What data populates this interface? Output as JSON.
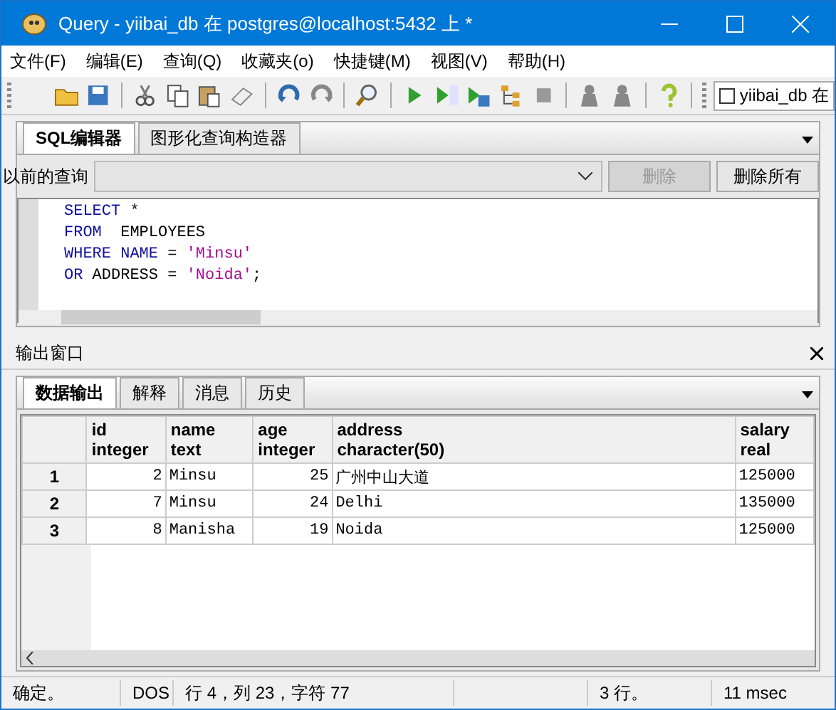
{
  "window": {
    "title": "Query - yiibai_db 在  postgres@localhost:5432 上 *"
  },
  "menu": [
    "文件(F)",
    "编辑(E)",
    "查询(Q)",
    "收藏夹(o)",
    "快捷键(M)",
    "视图(V)",
    "帮助(H)"
  ],
  "toolbar": {
    "database_combo": {
      "label": "yiibai_db 在",
      "checked": false
    }
  },
  "editor_tabs": [
    {
      "label": "SQL编辑器",
      "selected": true
    },
    {
      "label": "图形化查询构造器",
      "selected": false
    }
  ],
  "previous_queries": {
    "label": "以前的查询",
    "buttons": [
      {
        "label": "删除",
        "disabled": true
      },
      {
        "label": "删除所有",
        "disabled": false
      }
    ]
  },
  "sql_lines": [
    [
      {
        "kind": "keyword",
        "text": "SELECT"
      },
      {
        "kind": "plain",
        "text": " *"
      }
    ],
    [
      {
        "kind": "keyword",
        "text": "FROM"
      },
      {
        "kind": "plain",
        "text": "  EMPLOYEES"
      }
    ],
    [
      {
        "kind": "keyword",
        "text": "WHERE NAME"
      },
      {
        "kind": "plain",
        "text": " = "
      },
      {
        "kind": "string",
        "text": "'Minsu'"
      }
    ],
    [
      {
        "kind": "keyword",
        "text": "OR"
      },
      {
        "kind": "plain",
        "text": " ADDRESS = "
      },
      {
        "kind": "string",
        "text": "'Noida'"
      },
      {
        "kind": "plain",
        "text": ";"
      }
    ]
  ],
  "output": {
    "title": "输出窗口",
    "tabs": [
      {
        "label": "数据输出",
        "selected": true
      },
      {
        "label": "解释",
        "selected": false
      },
      {
        "label": "消息",
        "selected": false
      },
      {
        "label": "历史",
        "selected": false
      }
    ],
    "table": {
      "columns": [
        {
          "name": "id",
          "type": "integer"
        },
        {
          "name": "name",
          "type": "text"
        },
        {
          "name": "age",
          "type": "integer"
        },
        {
          "name": "address",
          "type": "character(50)"
        },
        {
          "name": "salary",
          "type": "real"
        }
      ],
      "rows": [
        {
          "number": "1",
          "cells": [
            "2",
            "Minsu",
            "25",
            "广州中山大道",
            "125000"
          ]
        },
        {
          "number": "2",
          "cells": [
            "7",
            "Minsu",
            "24",
            "Delhi",
            "135000"
          ]
        },
        {
          "number": "3",
          "cells": [
            "8",
            "Manisha",
            "19",
            "Noida",
            "125000"
          ]
        }
      ]
    }
  },
  "status_bar": [
    "确定。",
    "DOS",
    "行 4，列 23，字符 77",
    "3 行。",
    "11 msec"
  ]
}
